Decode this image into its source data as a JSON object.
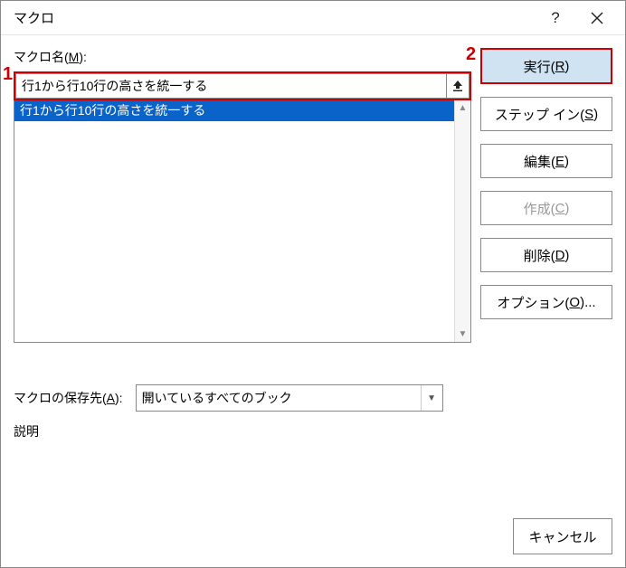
{
  "titlebar": {
    "title": "マクロ",
    "help": "?"
  },
  "labels": {
    "macro_name_prefix": "マクロ名(",
    "macro_name_mn": "M",
    "macro_name_suffix": "):",
    "storage_prefix": "マクロの保存先(",
    "storage_mn": "A",
    "storage_suffix": "):",
    "description": "説明"
  },
  "macro_name_value": "行1から行10行の高さを統一する",
  "macro_list": [
    "行1から行10行の高さを統一する"
  ],
  "storage_value": "開いているすべてのブック",
  "buttons": {
    "run_prefix": "実行(",
    "run_mn": "R",
    "run_suffix": ")",
    "step_prefix": "ステップ イン(",
    "step_mn": "S",
    "step_suffix": ")",
    "edit_prefix": "編集(",
    "edit_mn": "E",
    "edit_suffix": ")",
    "create_prefix": "作成(",
    "create_mn": "C",
    "create_suffix": ")",
    "delete_prefix": "削除(",
    "delete_mn": "D",
    "delete_suffix": ")",
    "options_prefix": "オプション(",
    "options_mn": "O",
    "options_suffix": ")...",
    "cancel": "キャンセル"
  },
  "annotations": {
    "a1": "1",
    "a2": "2"
  }
}
